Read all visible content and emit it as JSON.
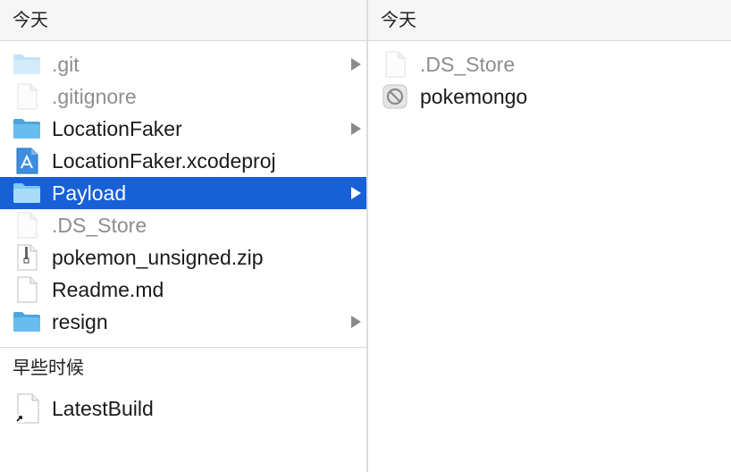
{
  "left": {
    "header": "今天",
    "items": [
      {
        "name": ".git",
        "icon": "folder-icon",
        "dim": true
      },
      {
        "name": ".gitignore",
        "icon": "file-icon",
        "dim": true
      },
      {
        "name": "LocationFaker",
        "icon": "folder-icon",
        "dim": false
      },
      {
        "name": "LocationFaker.xcodeproj",
        "icon": "xcode-project-icon",
        "dim": false
      },
      {
        "name": "Payload",
        "icon": "folder-icon",
        "dim": false
      },
      {
        "name": ".DS_Store",
        "icon": "file-icon",
        "dim": true
      },
      {
        "name": "pokemon_unsigned.zip",
        "icon": "zip-file-icon",
        "dim": false
      },
      {
        "name": "Readme.md",
        "icon": "file-icon",
        "dim": false
      },
      {
        "name": "resign",
        "icon": "folder-icon",
        "dim": false
      }
    ],
    "earlier_header": "早些时候",
    "earlier_items": [
      {
        "name": "LatestBuild",
        "icon": "alias-file-icon"
      }
    ]
  },
  "right": {
    "header": "今天",
    "items": [
      {
        "name": ".DS_Store",
        "icon": "file-icon",
        "dim": true
      },
      {
        "name": "pokemongo",
        "icon": "app-disabled-icon",
        "dim": false
      }
    ]
  },
  "colors": {
    "selection": "#1860d6",
    "folder": "#5fb8ea"
  }
}
